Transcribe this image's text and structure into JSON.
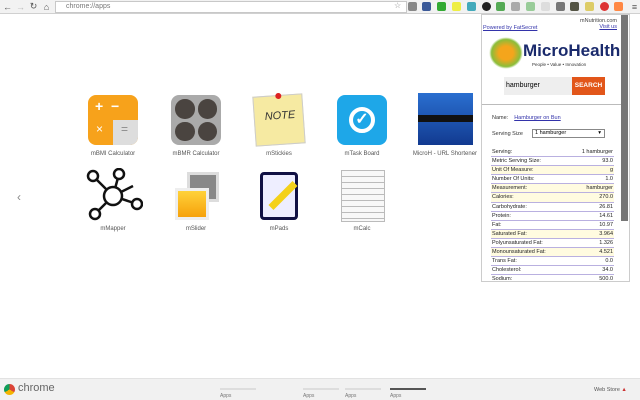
{
  "browser": {
    "url": "chrome://apps"
  },
  "apps": [
    {
      "label": "mBMI Calculator"
    },
    {
      "label": "mBMR Calculator"
    },
    {
      "label": "mStickies"
    },
    {
      "label": "mTask Board"
    },
    {
      "label": "MicroH - URL Shortener"
    },
    {
      "label": "mMapper"
    },
    {
      "label": "mSlider"
    },
    {
      "label": "mPads"
    },
    {
      "label": "mCalc"
    }
  ],
  "popup": {
    "powered_by": "Powered by FatSecret",
    "account": "mNutrition.com",
    "visit": "Visit us",
    "logo_title": "MicroHealth",
    "logo_tagline": "People • Value • Innovation",
    "search_value": "hamburger",
    "search_button": "SEARCH",
    "name_label": "Name:",
    "name_value": "Hamburger on Bun",
    "serving_label": "Serving Size",
    "serving_value": "1 hamburger",
    "rows": [
      {
        "k": "Serving:",
        "v": "1 hamburger"
      },
      {
        "k": "Metric Serving Size:",
        "v": "93.0"
      },
      {
        "k": "Unit Of Measure:",
        "v": "g"
      },
      {
        "k": "Number Of Units:",
        "v": "1.0"
      },
      {
        "k": "Measurement:",
        "v": "hamburger"
      },
      {
        "k": "Calories:",
        "v": "270.0"
      },
      {
        "k": "Carbohydrate:",
        "v": "26.81"
      },
      {
        "k": "Protein:",
        "v": "14.61"
      },
      {
        "k": "Fat:",
        "v": "10.97"
      },
      {
        "k": "Saturated Fat:",
        "v": "3.964"
      },
      {
        "k": "Polyunsaturated Fat:",
        "v": "1.326"
      },
      {
        "k": "Monounsaturated Fat:",
        "v": "4.521"
      },
      {
        "k": "Trans Fat:",
        "v": "0.0"
      },
      {
        "k": "Cholesterol:",
        "v": "34.0"
      },
      {
        "k": "Sodium:",
        "v": "500.0"
      }
    ]
  },
  "bottom": {
    "brand": "chrome",
    "pages": [
      "Apps",
      "Apps",
      "Apps",
      "Apps"
    ],
    "web_store": "Web Store"
  }
}
